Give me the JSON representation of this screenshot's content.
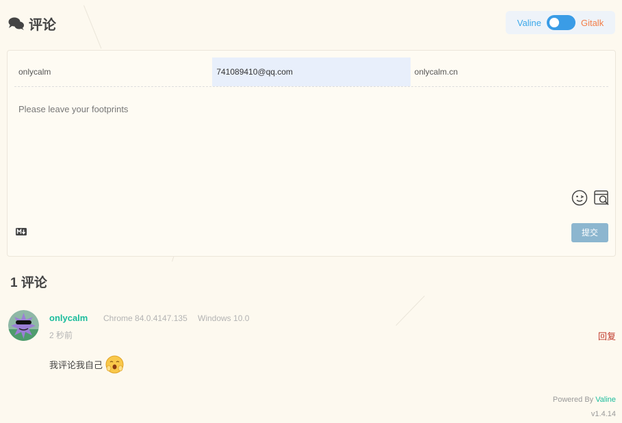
{
  "header": {
    "title": "评论"
  },
  "switcher": {
    "left_label": "Valine",
    "right_label": "Gitalk"
  },
  "form": {
    "nick_value": "onlycalm",
    "mail_value": "741089410@qq.com",
    "link_value": "onlycalm.cn",
    "textarea_placeholder": "Please leave your footprints",
    "submit_label": "提交",
    "markdown_icon": "markdown-icon",
    "emoji_icon": "emoji-icon",
    "preview_icon": "preview-icon"
  },
  "comments": {
    "count_label": "1 评论",
    "items": [
      {
        "nick": "onlycalm",
        "browser": "Chrome 84.0.4147.135",
        "os": "Windows 10.0",
        "time": "2 秒前",
        "reply_label": "回复",
        "text": "我评论我自己"
      }
    ]
  },
  "footer": {
    "powered_prefix": "Powered By",
    "powered_brand": "Valine",
    "version": "v1.4.14"
  },
  "colors": {
    "accent": "#1abc9c",
    "toggle": "#3a9ce6",
    "submit": "#8cb6cf",
    "reply": "#c0392b"
  }
}
